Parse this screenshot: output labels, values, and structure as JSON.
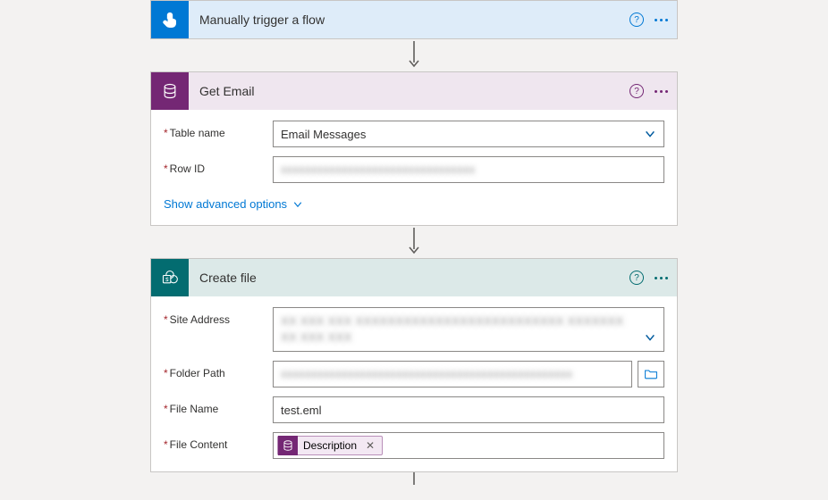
{
  "trigger": {
    "title": "Manually trigger a flow"
  },
  "getEmail": {
    "title": "Get Email",
    "fields": {
      "tableName": {
        "label": "Table name",
        "value": "Email Messages"
      },
      "rowId": {
        "label": "Row ID",
        "value": "xxxxxxxxxxxxxxxxxxxxxxxxxxxxxxxx"
      }
    },
    "advanced": "Show advanced options"
  },
  "createFile": {
    "title": "Create file",
    "fields": {
      "siteAddress": {
        "label": "Site Address",
        "value": "XX XXX XXX  XXXXXXXXXXXXXXXXXXXXXXXXXX XXXXXXX XX XXX XXX"
      },
      "folderPath": {
        "label": "Folder Path",
        "value": "xxxxxxxxxxxxxxxxxxxxxxxxxxxxxxxxxxxxxxxxxxxxxxxx"
      },
      "fileName": {
        "label": "File Name",
        "value": "test.eml"
      },
      "fileContent": {
        "label": "File Content",
        "chipLabel": "Description"
      }
    }
  },
  "icons": {
    "help_trigger_color": "#0078d4",
    "help_getemail_color": "#742774",
    "help_createfile_color": "#036c70"
  }
}
